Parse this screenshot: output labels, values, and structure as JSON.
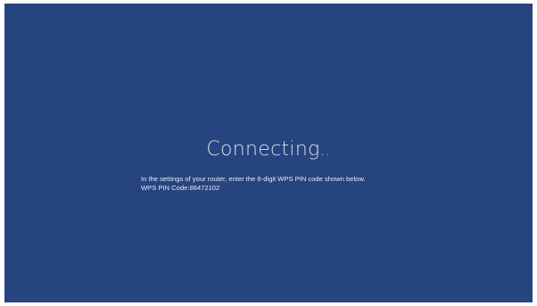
{
  "screen": {
    "title": "Connecting",
    "title_dots": "..",
    "instruction": "In the settings of your router, enter the 8-digit WPS PIN code shown below.",
    "pin_label": "WPS PIN Code:",
    "pin_code": "88472102",
    "background_color": "#26447f"
  }
}
